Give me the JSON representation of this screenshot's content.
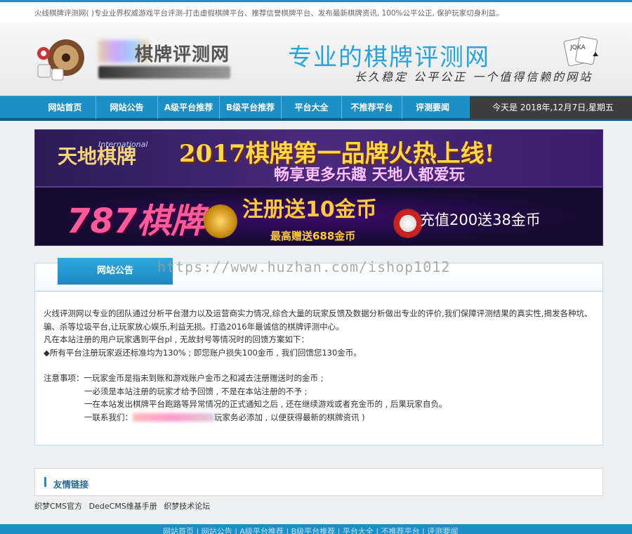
{
  "topbar": {
    "text": "火线棋牌评测网(                 )专业业界权威游戏平台评测-打击虚假棋牌平台、推荐信誉棋牌平台、发布最新棋牌资讯, 100%公平公正, 保护玩家切身利益。"
  },
  "header": {
    "logo_text": "棋牌评测网",
    "slogan_main": "专业的棋牌评测网",
    "slogan_sub": "长久稳定 公平公正  一个值得信赖的网站",
    "cards_label": "JQKA"
  },
  "nav": {
    "items": [
      "网站首页",
      "网站公告",
      "A级平台推荐",
      "B级平台推荐",
      "平台大全",
      "不推荐平台",
      "评测要闻"
    ],
    "date": "今天是 2018年,12月7日,星期五"
  },
  "banners": {
    "b1_logo_cn": "天地棋牌",
    "b1_logo_en": "International",
    "b1_title": "2017棋牌第一品牌火热上线!",
    "b1_sub": "畅享更多乐趣  天地人都爱玩",
    "b2_logo": "787棋牌",
    "b2_main": "注册送10金币",
    "b2_foot": "最高赠送688金币",
    "b2_right": "充值200送38金币"
  },
  "notice": {
    "tab": "网站公告",
    "watermark": "https://www.huzhan.com/ishop1012",
    "p1": "火线评测网以专业的团队通过分析平台潜力以及运营商实力情况,综合大量的玩家反馈及数据分析做出专业的评价,我们保障评测结果的真实性,揭发各种坑、骗、杀等垃圾平台,让玩家放心娱乐,利益无损。打造2016年最诚信的棋牌评测中心。",
    "p2": "凡在本站注册的用户玩家遇到平台pl , 无故封号等情况时的回馈方案如下：",
    "p3": "◆所有平台注册玩家返还标准均为130% ; 即您账户损失100金币 , 我们回馈您130金币。",
    "note_label": "注意事项：",
    "n1": "一玩家金币是指未到账和游戏账户金币之和减去注册赠送时的金币 ;",
    "n2": "一必须是本站注册的玩家才给予回馈 , 不是在本站注册的不予 ;",
    "n3": "一在本站发出棋牌平台跑路等异常情况的正式通知之后 , 还在继续游戏或者充金币的 , 后果玩家自负。",
    "n4a": "一联系我们：",
    "n4b": "玩家务必添加 , 以便获得最新的棋牌资讯 )"
  },
  "friend": {
    "title": "友情链接",
    "links": [
      "织梦CMS官方",
      "DedeCMS维基手册",
      "织梦技术论坛"
    ]
  },
  "footer": {
    "text": "网站首页 | 网站公告 | A级平台推荐 | B级平台推荐 | 平台大全 | 不推荐平台 | 评测要闻"
  },
  "colors": {
    "accent": "#1d8fc7",
    "nav_dark": "#0d5f8b",
    "date_bg": "#3e3e3e",
    "slogan": "#2aa3d8"
  }
}
